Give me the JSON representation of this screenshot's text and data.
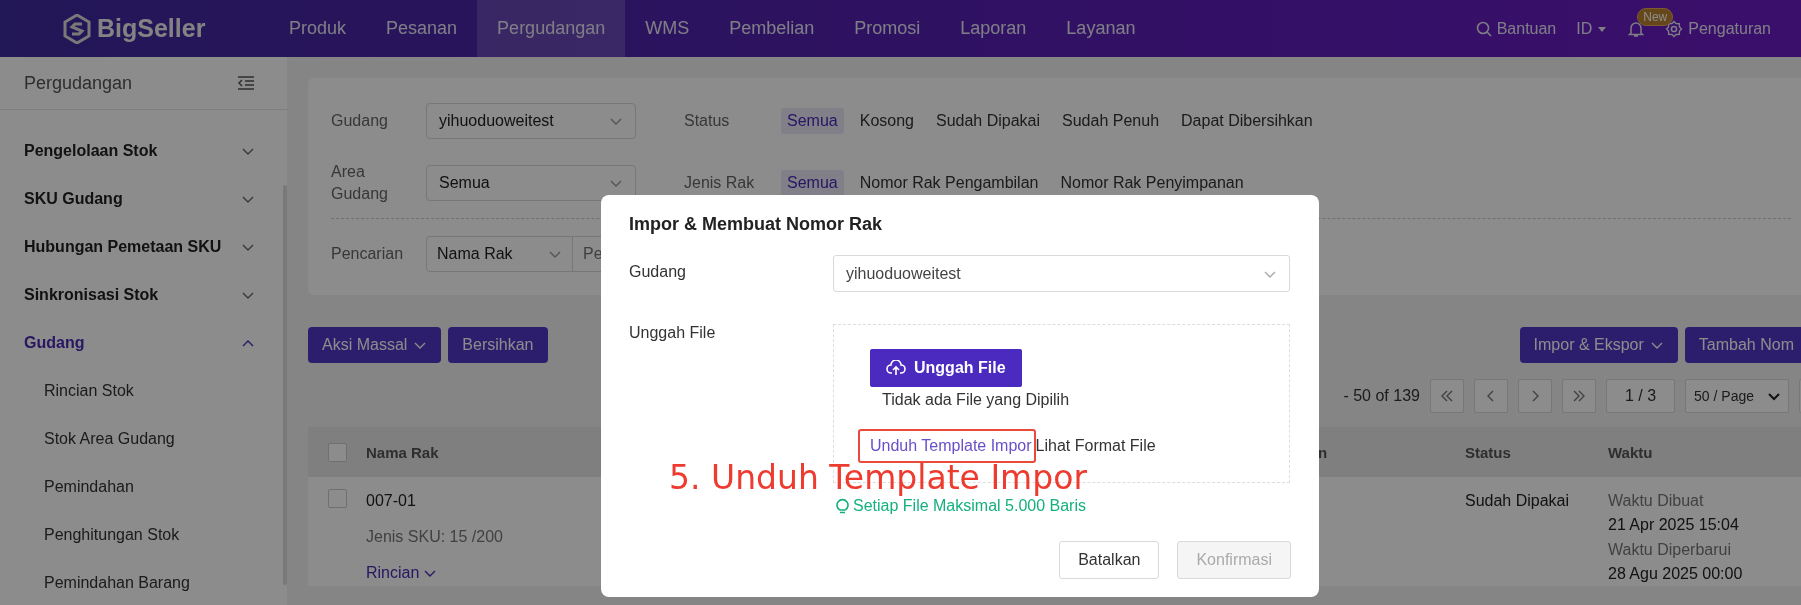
{
  "top_bar": {
    "logo": "BigSeller",
    "nav": [
      {
        "label": "Produk",
        "selected": false
      },
      {
        "label": "Pesanan",
        "selected": false
      },
      {
        "label": "Pergudangan",
        "selected": true
      },
      {
        "label": "WMS",
        "selected": false
      },
      {
        "label": "Pembelian",
        "selected": false
      },
      {
        "label": "Promosi",
        "selected": false
      },
      {
        "label": "Laporan",
        "selected": false
      },
      {
        "label": "Layanan",
        "selected": false
      }
    ],
    "help": "Bantuan",
    "language": "ID",
    "notification_badge": "New",
    "settings": "Pengaturan"
  },
  "sidebar": {
    "title": "Pergudangan",
    "items": [
      {
        "label": "Pengelolaan Stok",
        "expanded": false,
        "selected": false
      },
      {
        "label": "SKU Gudang",
        "expanded": false,
        "selected": false
      },
      {
        "label": "Hubungan Pemetaan SKU",
        "expanded": false,
        "selected": false
      },
      {
        "label": "Sinkronisasi Stok",
        "expanded": false,
        "selected": false
      },
      {
        "label": "Gudang",
        "expanded": true,
        "selected": true,
        "children": [
          {
            "label": "Rincian Stok",
            "selected": false
          },
          {
            "label": "Stok Area Gudang",
            "selected": false
          },
          {
            "label": "Pemindahan",
            "selected": false
          },
          {
            "label": "Penghitungan Stok",
            "selected": false
          },
          {
            "label": "Pemindahan Barang",
            "selected": false
          }
        ]
      }
    ]
  },
  "filters": {
    "warehouse": {
      "label": "Gudang",
      "value": "yihuoduoweitest"
    },
    "area": {
      "label": "Area Gudang",
      "value": "Semua"
    },
    "search": {
      "label": "Pencarian",
      "field": "Nama Rak",
      "placeholder": "Pe"
    },
    "status": {
      "label": "Status",
      "options": [
        {
          "label": "Semua",
          "selected": true
        },
        {
          "label": "Kosong",
          "selected": false
        },
        {
          "label": "Sudah Dipakai",
          "selected": false
        },
        {
          "label": "Sudah Penuh",
          "selected": false
        },
        {
          "label": "Dapat Dibersihkan",
          "selected": false
        }
      ]
    },
    "rack_type": {
      "label": "Jenis Rak",
      "options": [
        {
          "label": "Semua",
          "selected": true
        },
        {
          "label": "Nomor Rak Pengambilan",
          "selected": false
        },
        {
          "label": "Nomor Rak Penyimpanan",
          "selected": false
        }
      ]
    }
  },
  "toolbar": {
    "left_buttons": [
      {
        "label": "Aksi Massal",
        "dropdown": true
      },
      {
        "label": "Bersihkan",
        "dropdown": false
      }
    ],
    "right_buttons": [
      {
        "label": "Impor & Ekspor",
        "dropdown": true
      },
      {
        "label": "Tambah Nom",
        "dropdown": false
      }
    ]
  },
  "pagination": {
    "range": "- 50 of 139",
    "page": "1 / 3",
    "page_size": "50 / Page"
  },
  "table": {
    "header_checked": false,
    "columns": [
      "Nama Rak",
      "n",
      "Status",
      "Waktu"
    ],
    "rows": [
      {
        "checked": false,
        "name": "007-01",
        "sku": "Jenis SKU: 15 /200",
        "details_link": "Rincian",
        "status": "Sudah Dipakai",
        "created_label": "Waktu Dibuat",
        "created": "21 Apr 2025 15:04",
        "updated_label": "Waktu Diperbarui",
        "updated": "28 Agu 2025 00:00"
      }
    ]
  },
  "dialog": {
    "title": "Impor & Membuat Nomor Rak",
    "warehouse_label": "Gudang",
    "warehouse_value": "yihuoduoweitest",
    "upload_label": "Unggah File",
    "upload_button": "Unggah File",
    "no_file": "Tidak ada File yang Dipilih",
    "template_link": "Unduh Template Impor",
    "format_link": "Lihat Format File",
    "hint": "Setiap File Maksimal 5.000 Baris",
    "buttons": [
      {
        "label": "Batalkan",
        "disabled": false
      },
      {
        "label": "Konfirmasi",
        "disabled": true
      }
    ]
  },
  "annotation": {
    "text": "5. Unduh Template Impor"
  }
}
